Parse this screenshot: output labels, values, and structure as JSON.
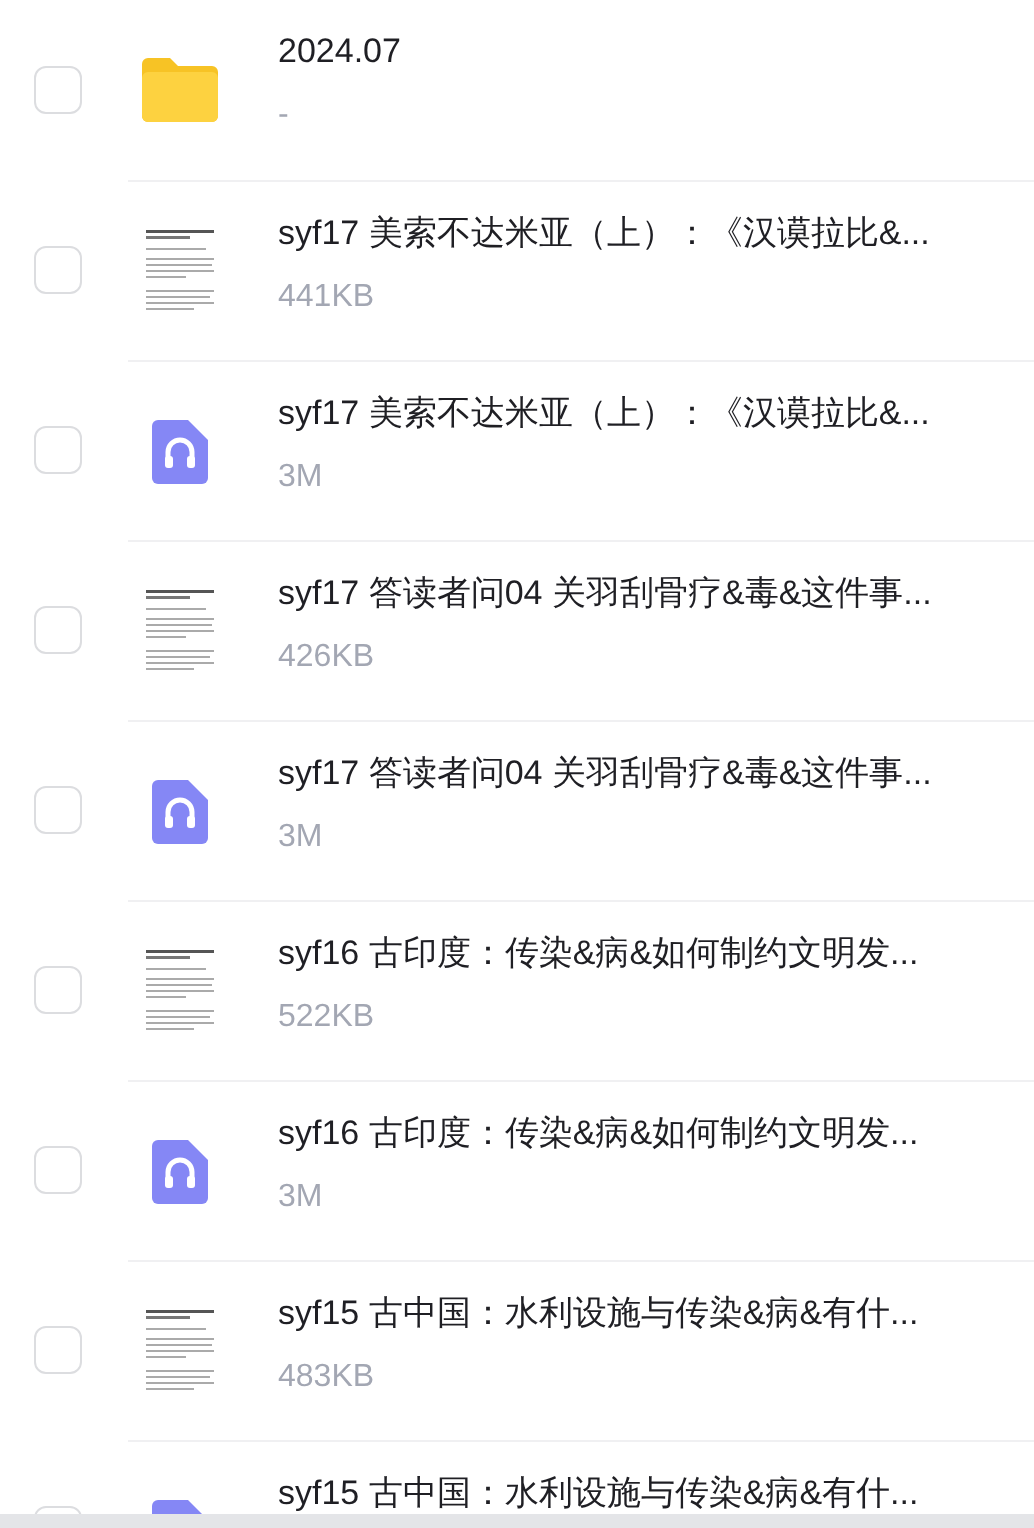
{
  "files": [
    {
      "kind": "folder",
      "name": "2024.07",
      "detail": "-",
      "checked": false
    },
    {
      "kind": "document",
      "name": "syf17 美索不达米亚（上）：《汉谟拉比&...",
      "detail": "441KB",
      "checked": false
    },
    {
      "kind": "audio",
      "name": "syf17 美索不达米亚（上）：《汉谟拉比&...",
      "detail": "3M",
      "checked": false
    },
    {
      "kind": "document",
      "name": "syf17 答读者问04 关羽刮骨疗&毒&这件事...",
      "detail": "426KB",
      "checked": false
    },
    {
      "kind": "audio",
      "name": "syf17 答读者问04 关羽刮骨疗&毒&这件事...",
      "detail": "3M",
      "checked": false
    },
    {
      "kind": "document",
      "name": "syf16 古印度：传染&病&如何制约文明发...",
      "detail": "522KB",
      "checked": false
    },
    {
      "kind": "audio",
      "name": "syf16 古印度：传染&病&如何制约文明发...",
      "detail": "3M",
      "checked": false
    },
    {
      "kind": "document",
      "name": "syf15 古中国：水利设施与传染&病&有什...",
      "detail": "483KB",
      "checked": false
    },
    {
      "kind": "audio",
      "name": "syf15 古中国：水利设施与传染&病&有什...",
      "checked": false
    }
  ]
}
